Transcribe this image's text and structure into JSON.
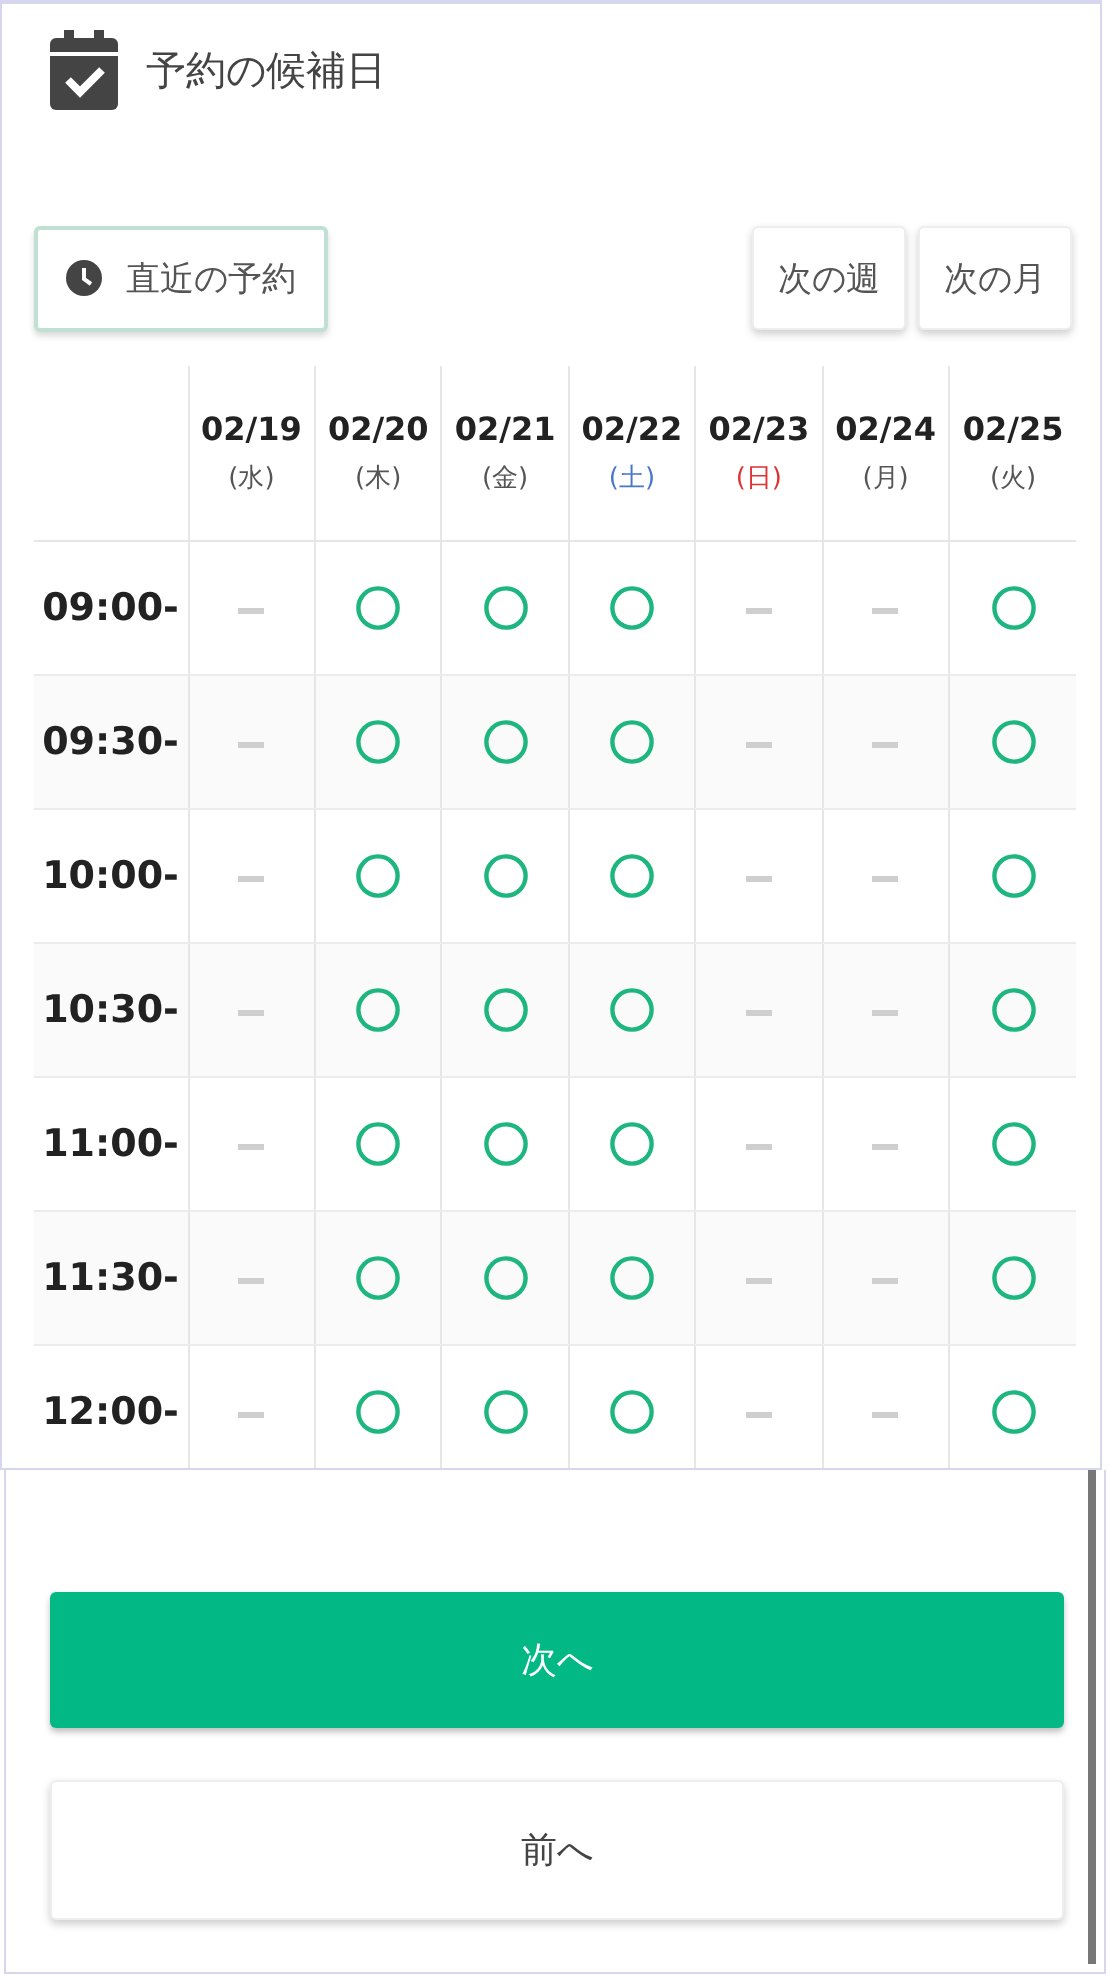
{
  "header": {
    "title": "予約の候補日"
  },
  "toolbar": {
    "recent_button": "直近の予約",
    "next_week_button": "次の週",
    "next_month_button": "次の月"
  },
  "days": [
    {
      "date": "02/19",
      "weekday": "(水)",
      "kind": "weekday"
    },
    {
      "date": "02/20",
      "weekday": "(木)",
      "kind": "weekday"
    },
    {
      "date": "02/21",
      "weekday": "(金)",
      "kind": "weekday"
    },
    {
      "date": "02/22",
      "weekday": "(土)",
      "kind": "saturday"
    },
    {
      "date": "02/23",
      "weekday": "(日)",
      "kind": "sunday"
    },
    {
      "date": "02/24",
      "weekday": "(月)",
      "kind": "weekday"
    },
    {
      "date": "02/25",
      "weekday": "(火)",
      "kind": "weekday"
    }
  ],
  "rows": [
    {
      "time": "09:00-",
      "available": [
        false,
        true,
        true,
        true,
        false,
        false,
        true
      ]
    },
    {
      "time": "09:30-",
      "available": [
        false,
        true,
        true,
        true,
        false,
        false,
        true
      ]
    },
    {
      "time": "10:00-",
      "available": [
        false,
        true,
        true,
        true,
        false,
        false,
        true
      ]
    },
    {
      "time": "10:30-",
      "available": [
        false,
        true,
        true,
        true,
        false,
        false,
        true
      ]
    },
    {
      "time": "11:00-",
      "available": [
        false,
        true,
        true,
        true,
        false,
        false,
        true
      ]
    },
    {
      "time": "11:30-",
      "available": [
        false,
        true,
        true,
        true,
        false,
        false,
        true
      ]
    },
    {
      "time": "12:00-",
      "available": [
        false,
        true,
        true,
        true,
        false,
        false,
        true
      ]
    }
  ],
  "footer": {
    "next_button": "次へ",
    "back_button": "前へ"
  }
}
